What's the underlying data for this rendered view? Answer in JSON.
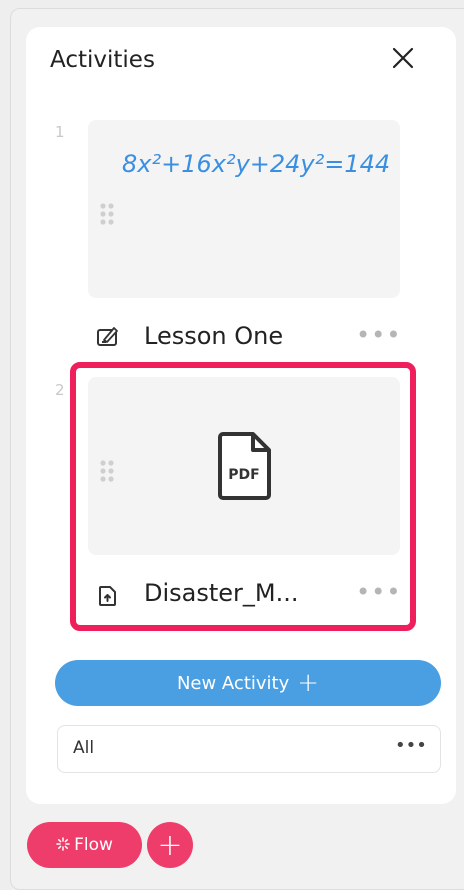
{
  "panel": {
    "title": "Activities",
    "close_icon": "close-icon"
  },
  "activities": [
    {
      "number": "1",
      "label": "Lesson One",
      "type_icon": "whiteboard-icon",
      "more_label": "•••",
      "equation": "8x²+16x²y+24y²=144"
    },
    {
      "number": "2",
      "label": "Disaster_M...",
      "type_icon": "file-upload-icon",
      "more_label": "•••",
      "thumbnail_icon": "pdf-file-icon",
      "thumbnail_text": "PDF",
      "selected": true
    }
  ],
  "new_activity": {
    "label": "New Activity",
    "plus": "+"
  },
  "filter": {
    "label": "All",
    "more": "•••"
  },
  "footer": {
    "flow_label": "Flow",
    "flow_icon": "sparkle-icon",
    "add_icon": "plus-icon",
    "add_label": "+"
  },
  "colors": {
    "accent_blue": "#4a9fe2",
    "accent_pink": "#ef3d6b",
    "selection": "#ef1f5c",
    "ink_blue": "#3b8fe0"
  }
}
